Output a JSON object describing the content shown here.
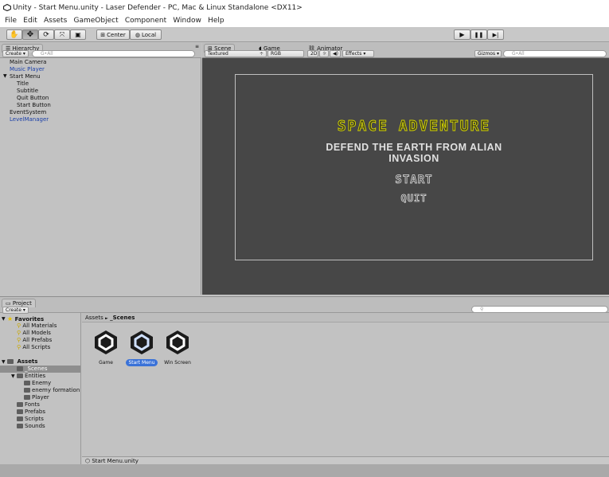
{
  "window": {
    "title": "Unity - Start Menu.unity - Laser Defender - PC, Mac & Linux Standalone <DX11>"
  },
  "menu": [
    "File",
    "Edit",
    "Assets",
    "GameObject",
    "Component",
    "Window",
    "Help"
  ],
  "toolbar": {
    "center_label": "Center",
    "local_label": "Local"
  },
  "hierarchy": {
    "tab": "Hierarchy",
    "create": "Create",
    "search_placeholder": "G•All",
    "items": [
      {
        "label": "Main Camera",
        "indent": 0,
        "color": "normal"
      },
      {
        "label": "Music Player",
        "indent": 0,
        "color": "blue"
      },
      {
        "label": "Start Menu",
        "indent": 0,
        "color": "normal",
        "expanded": true
      },
      {
        "label": "Title",
        "indent": 1,
        "color": "normal"
      },
      {
        "label": "Subtitle",
        "indent": 1,
        "color": "normal"
      },
      {
        "label": "Quit Button",
        "indent": 1,
        "color": "normal"
      },
      {
        "label": "Start Button",
        "indent": 1,
        "color": "normal"
      },
      {
        "label": "EventSystem",
        "indent": 0,
        "color": "normal"
      },
      {
        "label": "LevelManager",
        "indent": 0,
        "color": "blue"
      }
    ]
  },
  "scene_tabs": {
    "scene": "Scene",
    "game": "Game",
    "animator": "Animator"
  },
  "scene_toolbar": {
    "shading": "Textured",
    "render_mode": "RGB",
    "mode_2d": "2D",
    "effects": "Effects",
    "gizmos": "Gizmos",
    "search_placeholder": "G•All"
  },
  "game": {
    "title": "SPACE ADVENTURE",
    "subtitle_line1": "DEFEND THE EARTH FROM ALIAN",
    "subtitle_line2": "INVASION",
    "start": "START",
    "quit": "QUIT",
    "title_color": "#d6d600"
  },
  "project": {
    "tab": "Project",
    "create": "Create",
    "breadcrumb_root": "Assets",
    "breadcrumb_sep": "►",
    "breadcrumb_current": "_Scenes",
    "favorites_label": "Favorites",
    "favorites": [
      "All Materials",
      "All Models",
      "All Prefabs",
      "All Scripts"
    ],
    "assets_label": "Assets",
    "folders": [
      {
        "label": "_Scenes",
        "indent": 1,
        "selected": true
      },
      {
        "label": "Entities",
        "indent": 1
      },
      {
        "label": "Enemy",
        "indent": 2
      },
      {
        "label": "enemy formation",
        "indent": 2
      },
      {
        "label": "Player",
        "indent": 2
      },
      {
        "label": "Fonts",
        "indent": 1
      },
      {
        "label": "Prefabs",
        "indent": 1
      },
      {
        "label": "Scripts",
        "indent": 1
      },
      {
        "label": "Sounds",
        "indent": 1
      }
    ],
    "scene_assets": [
      {
        "label": "Game"
      },
      {
        "label": "Start Menu",
        "selected": true
      },
      {
        "label": "Win Screen"
      }
    ],
    "status_file": "Start Menu.unity"
  }
}
